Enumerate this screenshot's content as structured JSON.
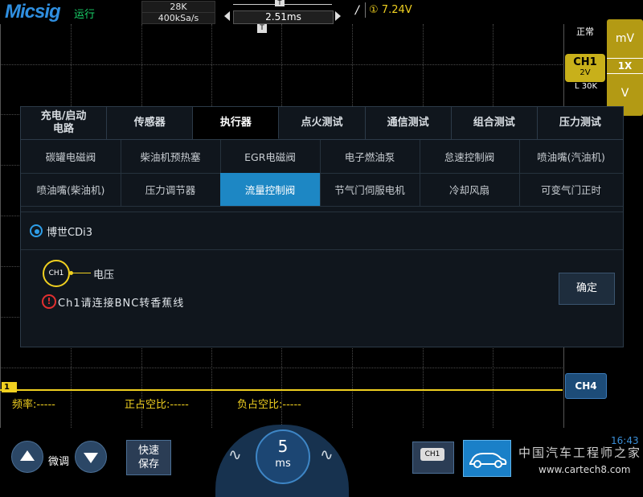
{
  "topbar": {
    "logo": "Micsig",
    "run_state": "运行",
    "memory_depth": "28K",
    "sample_rate": "400kSa/s",
    "time_delay": "2.51ms",
    "trigger_marker": "T",
    "trigger_slope_icon": "rising-edge-icon",
    "trigger_source": "①",
    "trigger_level": "7.24V"
  },
  "screen": {
    "ch1_marker": "1",
    "trigger_position_marker": "T",
    "measurements": [
      {
        "label": "频率:",
        "value": "-----"
      },
      {
        "label": "正占空比:",
        "value": "-----"
      },
      {
        "label": "负占空比:",
        "value": "-----"
      }
    ]
  },
  "right_panel": {
    "mode": "正常",
    "unit_top": "mV",
    "probe": "1X",
    "unit_bottom": "V",
    "ch1_label": "CH1",
    "ch1_scale": "2V",
    "ch1_coupling": "L 30K",
    "ch4_label": "CH4"
  },
  "dialog": {
    "tabs": [
      {
        "label": "充电/启动\n电路",
        "active": false
      },
      {
        "label": "传感器",
        "active": false
      },
      {
        "label": "执行器",
        "active": true
      },
      {
        "label": "点火测试",
        "active": false
      },
      {
        "label": "通信测试",
        "active": false
      },
      {
        "label": "组合测试",
        "active": false
      },
      {
        "label": "压力测试",
        "active": false
      }
    ],
    "items_row1": [
      "碳罐电磁阀",
      "柴油机预热塞",
      "EGR电磁阀",
      "电子燃油泵",
      "怠速控制阀",
      "喷油嘴(汽油机)"
    ],
    "items_row2": [
      "喷油嘴(柴油机)",
      "压力调节器",
      "流量控制阀",
      "节气门伺服电机",
      "冷却风扇",
      "可变气门正时"
    ],
    "selected_item": "流量控制阀",
    "option": "博世CDi3",
    "channel_badge": "CH1",
    "channel_signal": "电压",
    "warning": "Ch1请连接BNC转香蕉线",
    "confirm": "确定"
  },
  "bottom": {
    "fine_tune": "微调",
    "quick_save": "快速\n保存",
    "timebase_value": "5",
    "timebase_unit": "ms",
    "wave_left_icon": "sine-wave-icon",
    "wave_right_icon": "sine-wave-icon",
    "ch1_tile": "CH1",
    "car_icon": "car-icon",
    "clock": "16:43",
    "watermark_cn": "中国汽车工程师之家",
    "watermark_url": "www.cartech8.com"
  },
  "colors": {
    "ch1": "#f0d020",
    "accent": "#1d87c4",
    "dialog_bg": "#10161d"
  }
}
